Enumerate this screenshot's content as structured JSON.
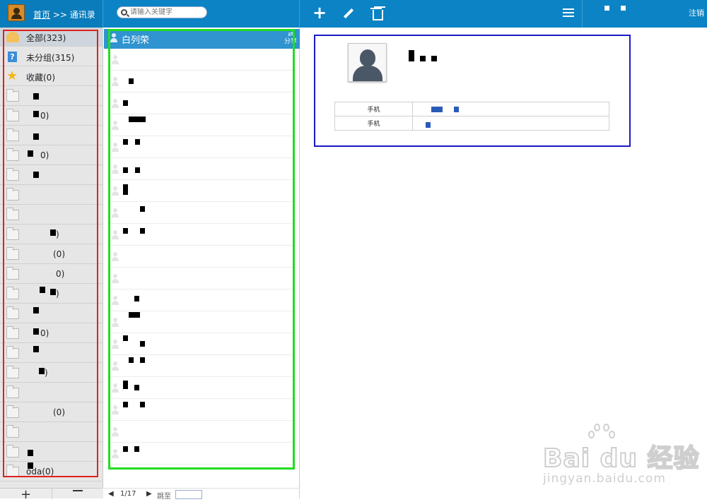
{
  "header": {
    "breadcrumb_home": "首页",
    "breadcrumb_sep": ">>",
    "breadcrumb_current": "通讯录",
    "logout_label": "注销"
  },
  "search": {
    "placeholder": "请输入关键字"
  },
  "sidebar": {
    "groups": [
      {
        "label": "全部(323)",
        "icon": "users-icon"
      },
      {
        "label": "未分组(315)",
        "icon": "question-icon"
      },
      {
        "label": "收藏(0)",
        "icon": "star-icon"
      }
    ],
    "folder_count_labels": [
      "0)",
      "0)",
      "0)",
      ")",
      "0)",
      "0)",
      "0)",
      "0)",
      "(0)",
      "oda(0)"
    ]
  },
  "contacts": {
    "selected_name": "白列荣",
    "share_label": "分享",
    "pager": {
      "prev": "◀",
      "page": "1/17",
      "next": "▶",
      "jump_label": "跳至"
    }
  },
  "detail": {
    "phones": [
      {
        "label": "手机"
      },
      {
        "label": "手机"
      }
    ]
  },
  "watermark": {
    "logo": "Bai du 经验",
    "url": "jingyan.baidu.com"
  },
  "colors": {
    "topbar": "#0b83c4",
    "list_header": "#2f94cf",
    "annotation_red": "#e02020",
    "annotation_green": "#22dd22",
    "annotation_blue": "#1a1ac8"
  }
}
